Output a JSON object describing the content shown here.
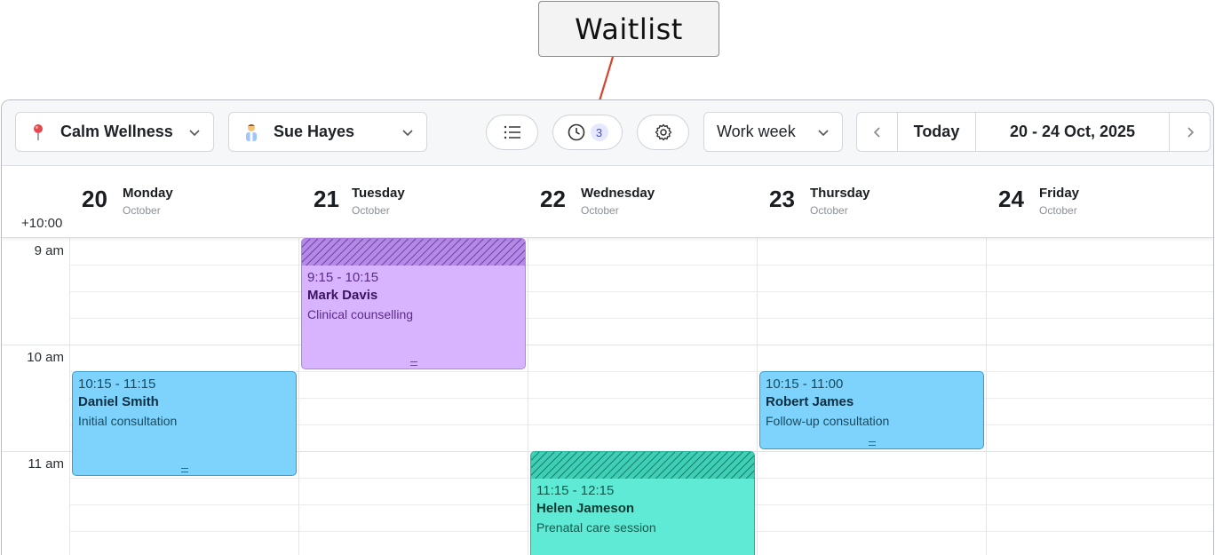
{
  "callout": {
    "text": "Waitlist"
  },
  "toolbar": {
    "location": "Calm Wellness",
    "practitioner": "Sue Hayes",
    "waitlist_count": "3",
    "view": "Work week",
    "today": "Today",
    "range": "20 - 24 Oct, 2025"
  },
  "timezone": "+10:00",
  "days": [
    {
      "num": "20",
      "name": "Monday",
      "month": "October"
    },
    {
      "num": "21",
      "name": "Tuesday",
      "month": "October"
    },
    {
      "num": "22",
      "name": "Wednesday",
      "month": "October"
    },
    {
      "num": "23",
      "name": "Thursday",
      "month": "October"
    },
    {
      "num": "24",
      "name": "Friday",
      "month": "October"
    }
  ],
  "hours": [
    "9 am",
    "10 am",
    "11 am"
  ],
  "events": [
    {
      "time": "9:15 - 10:15",
      "name": "Mark Davis",
      "type": "Clinical counselling",
      "color": "#d8b4fe"
    },
    {
      "time": "10:15 - 11:15",
      "name": "Daniel Smith",
      "type": "Initial consultation",
      "color": "#7dd3fc"
    },
    {
      "time": "10:15 - 11:00",
      "name": "Robert James",
      "type": "Follow-up consultation",
      "color": "#7dd3fc"
    },
    {
      "time": "11:15 - 12:15",
      "name": "Helen Jameson",
      "type": "Prenatal care session",
      "color": "#5eead4"
    }
  ]
}
